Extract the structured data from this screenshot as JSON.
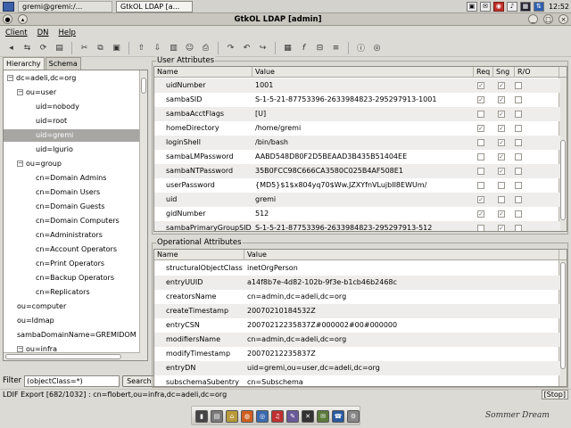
{
  "taskbar": {
    "tasks": [
      {
        "label": "gremi@gremi:/..."
      },
      {
        "label": "GtkOL LDAP [a..."
      }
    ],
    "clock": "12:52"
  },
  "window": {
    "title": "GtkOL LDAP [admin]"
  },
  "menu": {
    "items": [
      "Client",
      "DN",
      "Help"
    ]
  },
  "left": {
    "tabs": [
      "Hierarchy",
      "Schema"
    ],
    "tree": [
      {
        "label": "dc=adeli,dc=org",
        "depth": 0,
        "toggle": "minus"
      },
      {
        "label": "ou=user",
        "depth": 1,
        "toggle": "minus"
      },
      {
        "label": "uid=nobody",
        "depth": 2
      },
      {
        "label": "uid=root",
        "depth": 2
      },
      {
        "label": "uid=gremi",
        "depth": 2,
        "selected": true
      },
      {
        "label": "uid=lgurio",
        "depth": 2
      },
      {
        "label": "ou=group",
        "depth": 1,
        "toggle": "minus"
      },
      {
        "label": "cn=Domain Admins",
        "depth": 2
      },
      {
        "label": "cn=Domain Users",
        "depth": 2
      },
      {
        "label": "cn=Domain Guests",
        "depth": 2
      },
      {
        "label": "cn=Domain Computers",
        "depth": 2
      },
      {
        "label": "cn=Administrators",
        "depth": 2
      },
      {
        "label": "cn=Account Operators",
        "depth": 2
      },
      {
        "label": "cn=Print Operators",
        "depth": 2
      },
      {
        "label": "cn=Backup Operators",
        "depth": 2
      },
      {
        "label": "cn=Replicators",
        "depth": 2
      },
      {
        "label": "ou=computer",
        "depth": 1
      },
      {
        "label": "ou=ldmap",
        "depth": 1
      },
      {
        "label": "sambaDomainName=GREMIDOM",
        "depth": 1
      },
      {
        "label": "ou=infra",
        "depth": 1,
        "toggle": "minus"
      },
      {
        "label": "cn=airforce",
        "depth": 2
      }
    ],
    "filter_label": "Filter",
    "filter_value": "(objectClass=*)",
    "search_label": "Search"
  },
  "user_attributes": {
    "title": "User Attributes",
    "columns": [
      "Name",
      "Value",
      "Req",
      "Sng",
      "R/O"
    ],
    "rows": [
      {
        "name": "uidNumber",
        "value": "1001",
        "req": true,
        "sng": true,
        "ro": false
      },
      {
        "name": "sambaSID",
        "value": "S-1-5-21-87753396-2633984823-295297913-1001",
        "req": true,
        "sng": true,
        "ro": false
      },
      {
        "name": "sambaAcctFlags",
        "value": "[U]",
        "req": false,
        "sng": true,
        "ro": false
      },
      {
        "name": "homeDirectory",
        "value": "/home/gremi",
        "req": true,
        "sng": true,
        "ro": false
      },
      {
        "name": "loginShell",
        "value": "/bin/bash",
        "req": false,
        "sng": true,
        "ro": false
      },
      {
        "name": "sambaLMPassword",
        "value": "AABD548D80F2D5BEAAD3B435B51404EE",
        "req": false,
        "sng": true,
        "ro": false
      },
      {
        "name": "sambaNTPassword",
        "value": "35B0FCC98C666CA3580C025B4AF508E1",
        "req": false,
        "sng": true,
        "ro": false
      },
      {
        "name": "userPassword",
        "value": "{MD5}$1$x804yq70$Ww.JZXYfnVLujbII8EWUm/",
        "req": false,
        "sng": false,
        "ro": false
      },
      {
        "name": "uid",
        "value": "gremi",
        "req": true,
        "sng": false,
        "ro": false
      },
      {
        "name": "gidNumber",
        "value": "512",
        "req": true,
        "sng": true,
        "ro": false
      },
      {
        "name": "sambaPrimaryGroupSID",
        "value": "S-1-5-21-87753396-2633984823-295297913-512",
        "req": false,
        "sng": true,
        "ro": false
      }
    ]
  },
  "operational_attributes": {
    "title": "Operational Attributes",
    "columns": [
      "Name",
      "Value"
    ],
    "rows": [
      {
        "name": "structuralObjectClass",
        "value": "inetOrgPerson"
      },
      {
        "name": "entryUUID",
        "value": "a14f8b7e-4d82-102b-9f3e-b1cb46b2468c"
      },
      {
        "name": "creatorsName",
        "value": "cn=admin,dc=adeli,dc=org"
      },
      {
        "name": "createTimestamp",
        "value": "20070210184532Z"
      },
      {
        "name": "entryCSN",
        "value": "20070212235837Z#000002#00#000000"
      },
      {
        "name": "modifiersName",
        "value": "cn=admin,dc=adeli,dc=org"
      },
      {
        "name": "modifyTimestamp",
        "value": "20070212235837Z"
      },
      {
        "name": "entryDN",
        "value": "uid=gremi,ou=user,dc=adeli,dc=org"
      },
      {
        "name": "subschemaSubentry",
        "value": "cn=Subschema"
      }
    ]
  },
  "status": {
    "text": "LDIF Export [682/1032] : cn=flobert,ou=infra,dc=adeli,dc=org",
    "stop_label": "[Stop]"
  },
  "signature": "Sommer Dream"
}
